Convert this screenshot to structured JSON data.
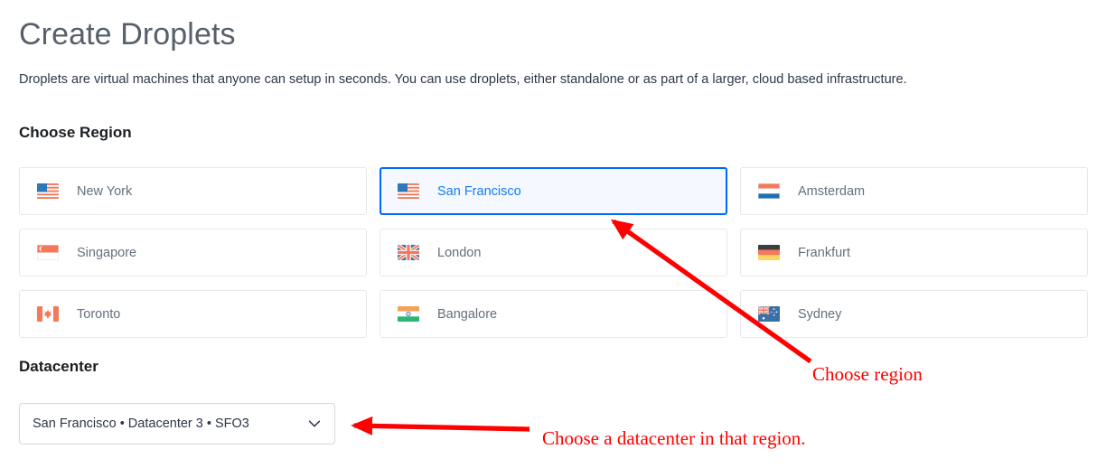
{
  "page": {
    "title": "Create Droplets",
    "description": "Droplets are virtual machines that anyone can setup in seconds. You can use droplets, either standalone or as part of a larger, cloud based infrastructure."
  },
  "region_section": {
    "heading": "Choose Region",
    "selected_region": "San Francisco",
    "cards": [
      {
        "label": "New York",
        "flag": "flag-us",
        "selected": false
      },
      {
        "label": "San Francisco",
        "flag": "flag-us",
        "selected": true
      },
      {
        "label": "Amsterdam",
        "flag": "flag-nl",
        "selected": false
      },
      {
        "label": "Singapore",
        "flag": "flag-sg",
        "selected": false
      },
      {
        "label": "London",
        "flag": "flag-gb",
        "selected": false
      },
      {
        "label": "Frankfurt",
        "flag": "flag-de",
        "selected": false
      },
      {
        "label": "Toronto",
        "flag": "flag-ca",
        "selected": false
      },
      {
        "label": "Bangalore",
        "flag": "flag-in",
        "selected": false
      },
      {
        "label": "Sydney",
        "flag": "flag-au",
        "selected": false
      }
    ]
  },
  "datacenter_section": {
    "heading": "Datacenter",
    "select_value": "San Francisco • Datacenter 3 • SFO3",
    "chevron_icon": "chevron-down-icon"
  },
  "annotations": [
    {
      "id": "anno-region",
      "text": "Choose region",
      "color": "#ff0000"
    },
    {
      "id": "anno-datacenter",
      "text": "Choose a datacenter in that region.",
      "color": "#ff0000"
    }
  ],
  "colors": {
    "accent_blue": "#0069ff",
    "selected_bg": "#f5f9ff",
    "selected_text": "#147af3",
    "card_border": "#e5e8ec",
    "label_gray": "#62707d",
    "title_gray": "#57606a",
    "annotation_red": "#ff0000"
  }
}
